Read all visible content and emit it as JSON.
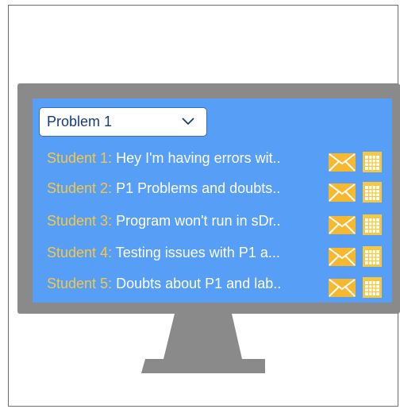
{
  "dropdown": {
    "selected": "Problem 1"
  },
  "students": [
    {
      "name": "Student 1",
      "message": "Hey I'm having errors wit.."
    },
    {
      "name": "Student 2",
      "message": "P1 Problems and doubts.."
    },
    {
      "name": "Student 3",
      "message": "Program won't run in sDr.."
    },
    {
      "name": "Student 4",
      "message": "Testing issues with P1 a..."
    },
    {
      "name": "Student 5",
      "message": "Doubts about P1 and lab.."
    }
  ],
  "colors": {
    "screen": "#579ef7",
    "bezel": "#8a8a8a",
    "student_name": "#f5c842",
    "message_text": "#ffffff",
    "mail_icon": "#f5b82e",
    "calendar_icon": "#f5c842"
  },
  "icons": [
    "mail-icon",
    "calendar-icon",
    "chevron-down-icon"
  ]
}
